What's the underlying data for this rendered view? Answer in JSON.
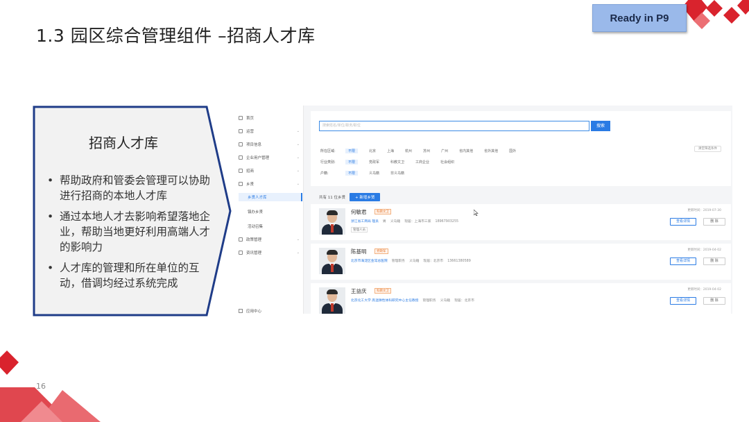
{
  "slide": {
    "title": "1.3 园区综合管理组件 –招商人才库",
    "badge": "Ready in P9",
    "page_number": "16"
  },
  "callout": {
    "heading": "招商人才库",
    "bullet_char": "•",
    "bullets": [
      "帮助政府和管委会管理可以协助进行招商的本地人才库",
      "通过本地人才去影响希望落地企业，帮助当地更好利用高端人才的影响力",
      "人才库的管理和所在单位的互动，借调均经过系统完成"
    ]
  },
  "colors": {
    "accent_red": "#d9232d",
    "callout_border": "#1f3c88",
    "callout_fill": "#f2f2f2",
    "primary_blue": "#2a7be4"
  },
  "app": {
    "sidebar": [
      {
        "label": "首页",
        "icon": "home-icon"
      },
      {
        "label": "运营",
        "icon": "grid-icon",
        "arrow": "⌄"
      },
      {
        "label": "项目信息",
        "icon": "project-icon",
        "arrow": "⌄"
      },
      {
        "label": "企业用户管理",
        "icon": "user-icon",
        "arrow": "⌄"
      },
      {
        "label": "招商",
        "icon": "globe-icon",
        "arrow": "⌄"
      },
      {
        "label": "乡贤",
        "icon": "people-icon",
        "arrow": "⌄"
      },
      {
        "label": "乡贤人才库",
        "active": true
      },
      {
        "label": "镇办乡贤",
        "sub": true
      },
      {
        "label": "活动召集",
        "sub": true
      },
      {
        "label": "政策管理",
        "icon": "doc-icon",
        "arrow": "⌄"
      },
      {
        "label": "资讯管理",
        "icon": "news-icon",
        "arrow": "⌄"
      }
    ],
    "app_center": "应用中心",
    "search": {
      "placeholder": "搜索姓名/单位/职务/职位",
      "button": "搜索"
    },
    "filters": [
      {
        "label": "所在区域:",
        "options": [
          "不限",
          "北京",
          "上海",
          "杭州",
          "苏州",
          "广州",
          "省内其他",
          "省外其他",
          "国外"
        ]
      },
      {
        "label": "行业类别:",
        "options": [
          "不限",
          "党政军",
          "科教文卫",
          "工商企业",
          "社会组织"
        ]
      },
      {
        "label": "户籍:",
        "options": [
          "不限",
          "义乌籍",
          "非义乌籍"
        ]
      }
    ],
    "clear_filters": "清空筛选条件",
    "count_text": "共有 11 位乡贤",
    "add_button": "+ 新增乡贤",
    "toolbar_overlay": "CK",
    "people": [
      {
        "name": "何敏君",
        "tag": "科教文卫",
        "org": "浙江省工商局 理员",
        "info": [
          "男",
          "义乌籍",
          "现居：上海市三家",
          "18967903255"
        ],
        "sub": "管理人员",
        "date": "更新时间：2019-07-30",
        "view": "查看详情",
        "delete": "删 除"
      },
      {
        "name": "陈基明",
        "tag": "党政军",
        "org": "北京市海淀区金常总医院",
        "info": [
          "管理职务",
          "义乌籍",
          "现居：北京市",
          "13661380589"
        ],
        "sub": "",
        "date": "更新时间：2019-04-02",
        "view": "查看详情",
        "delete": "删 除"
      },
      {
        "name": "王益庆",
        "tag": "科教文卫",
        "org": "北京化工大学 高温弹性体科研究中心主任教授",
        "info": [
          "管理职务",
          "义乌籍",
          "现居：北京市"
        ],
        "sub": "",
        "date": "更新时间：2019-04-02",
        "view": "查看详情",
        "delete": "删 除"
      }
    ]
  }
}
